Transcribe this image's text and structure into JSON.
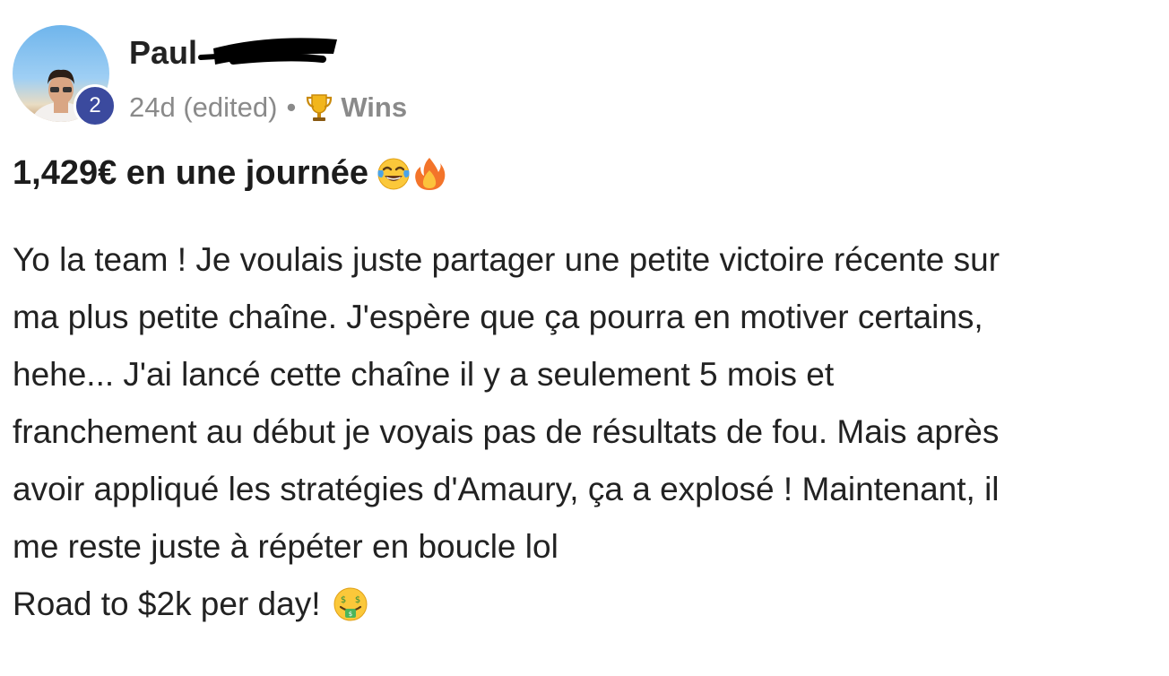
{
  "post": {
    "author": {
      "name": "Paul",
      "level": "2"
    },
    "meta": {
      "time": "24d (edited)",
      "separator": "•",
      "category_icon": "trophy-icon",
      "category": "Wins"
    },
    "title": "1,429€ en une journée",
    "title_emojis": [
      "tears-of-joy-emoji",
      "fire-emoji"
    ],
    "body_lines": [
      "Yo la team ! Je voulais juste partager une petite victoire récente sur",
      "ma plus petite chaîne. J'espère que ça pourra en motiver certains,",
      "hehe... J'ai lancé cette chaîne il y a seulement 5 mois et",
      "franchement au début je voyais pas de résultats de fou. Mais après",
      "avoir appliqué les stratégies d'Amaury, ça a explosé ! Maintenant, il",
      "me reste juste à répéter en boucle lol",
      "Road to $2k per day!"
    ],
    "closing_emoji": "money-mouth-emoji"
  },
  "colors": {
    "badge": "#3b4a9e",
    "meta_text": "#8a8a8a",
    "text": "#222222"
  }
}
